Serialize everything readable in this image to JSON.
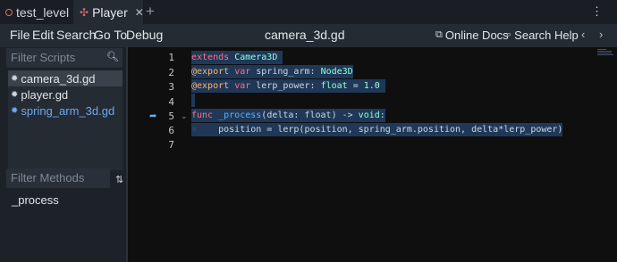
{
  "scene_tabs": [
    {
      "label": "test_level",
      "close": ""
    },
    {
      "label": "Player",
      "close": "✕"
    }
  ],
  "add_tab": "+",
  "menu": [
    "File",
    "Edit",
    "Search",
    "Go To",
    "Debug"
  ],
  "current_file": "camera_3d.gd",
  "online_docs": "Online Docs",
  "search_help": "Search Help",
  "nav_prev": "‹",
  "nav_next": "›",
  "filter_scripts_placeholder": "Filter Scripts",
  "scripts": [
    "camera_3d.gd",
    "player.gd",
    "spring_arm_3d.gd"
  ],
  "filter_methods_placeholder": "Filter Methods",
  "methods": [
    "_process"
  ],
  "line_numbers": [
    "1",
    "2",
    "3",
    "4",
    "5",
    "6",
    "7"
  ],
  "code": {
    "l1": {
      "kw": "extends",
      "type": "Camera3D"
    },
    "l2": {
      "annotation": "@export",
      "kw": "var",
      "name": "spring_arm",
      "colon": ":",
      "type": "Node3D"
    },
    "l3": {
      "annotation": "@export",
      "kw": "var",
      "name": "lerp_power",
      "colon": ":",
      "type": "float",
      "eq": "=",
      "value": "1.0"
    },
    "l5": {
      "kw": "func",
      "name": "_process",
      "params": "(delta: float) -> ",
      "ret": "void",
      "end": ":"
    },
    "l6": {
      "indent": "»",
      "text": "position = lerp(position, spring_arm.position, delta*lerp_power)"
    }
  }
}
